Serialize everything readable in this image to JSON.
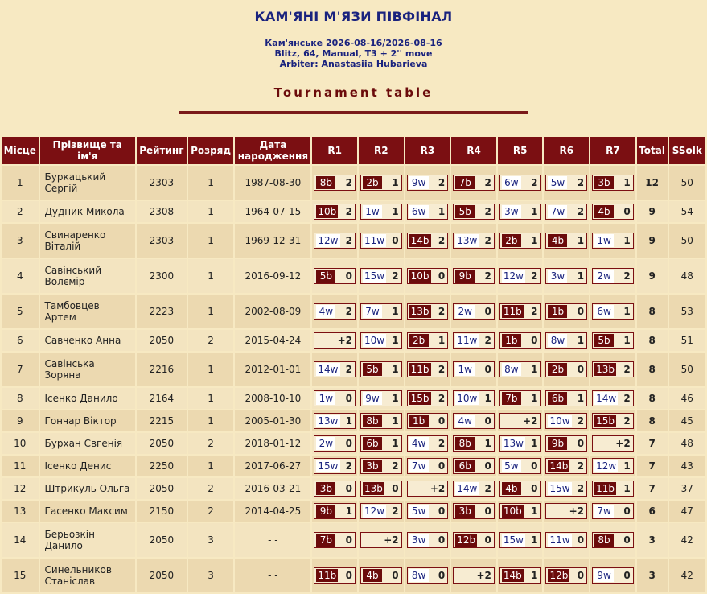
{
  "header": {
    "title": "КАМ'ЯНІ М'ЯЗИ ПІВФІНАЛ",
    "info_line1": "Кам'янське 2026-08-16/2026-08-16",
    "info_line2": "Blitz, 64, Manual, T3 + 2'' move",
    "info_line3": "Arbiter: Anastasiia Hubarieva",
    "subtitle": "Tournament table"
  },
  "columns": [
    "Місце",
    "Прізвище та ім'я",
    "Рейтинг",
    "Розряд",
    "Дата народження",
    "R1",
    "R2",
    "R3",
    "R4",
    "R5",
    "R6",
    "R7",
    "Total",
    "SSolk"
  ],
  "rows": [
    {
      "place": "1",
      "name1": "Буркацький",
      "name2": "Сергій",
      "rating": "2303",
      "rank": "1",
      "dob": "1987-08-30",
      "games": [
        [
          "8b",
          "2"
        ],
        [
          "2b",
          "1"
        ],
        [
          "9w",
          "2"
        ],
        [
          "7b",
          "2"
        ],
        [
          "6w",
          "2"
        ],
        [
          "5w",
          "2"
        ],
        [
          "3b",
          "1"
        ]
      ],
      "total": "12",
      "ssolk": "50"
    },
    {
      "place": "2",
      "name1": "Дудник Микола",
      "name2": "",
      "rating": "2308",
      "rank": "1",
      "dob": "1964-07-15",
      "games": [
        [
          "10b",
          "2"
        ],
        [
          "1w",
          "1"
        ],
        [
          "6w",
          "1"
        ],
        [
          "5b",
          "2"
        ],
        [
          "3w",
          "1"
        ],
        [
          "7w",
          "2"
        ],
        [
          "4b",
          "0"
        ]
      ],
      "total": "9",
      "ssolk": "54"
    },
    {
      "place": "3",
      "name1": "Свинаренко",
      "name2": "Віталій",
      "rating": "2303",
      "rank": "1",
      "dob": "1969-12-31",
      "games": [
        [
          "12w",
          "2"
        ],
        [
          "11w",
          "0"
        ],
        [
          "14b",
          "2"
        ],
        [
          "13w",
          "2"
        ],
        [
          "2b",
          "1"
        ],
        [
          "4b",
          "1"
        ],
        [
          "1w",
          "1"
        ]
      ],
      "total": "9",
      "ssolk": "50"
    },
    {
      "place": "4",
      "name1": "Савінський",
      "name2": "Волємір",
      "rating": "2300",
      "rank": "1",
      "dob": "2016-09-12",
      "games": [
        [
          "5b",
          "0"
        ],
        [
          "15w",
          "2"
        ],
        [
          "10b",
          "0"
        ],
        [
          "9b",
          "2"
        ],
        [
          "12w",
          "2"
        ],
        [
          "3w",
          "1"
        ],
        [
          "2w",
          "2"
        ]
      ],
      "total": "9",
      "ssolk": "48"
    },
    {
      "place": "5",
      "name1": "Тамбовцев",
      "name2": "Артем",
      "rating": "2223",
      "rank": "1",
      "dob": "2002-08-09",
      "games": [
        [
          "4w",
          "2"
        ],
        [
          "7w",
          "1"
        ],
        [
          "13b",
          "2"
        ],
        [
          "2w",
          "0"
        ],
        [
          "11b",
          "2"
        ],
        [
          "1b",
          "0"
        ],
        [
          "6w",
          "1"
        ]
      ],
      "total": "8",
      "ssolk": "53"
    },
    {
      "place": "6",
      "name1": "Савченко Анна",
      "name2": "",
      "rating": "2050",
      "rank": "2",
      "dob": "2015-04-24",
      "games": [
        [
          "",
          "+2"
        ],
        [
          "10w",
          "1"
        ],
        [
          "2b",
          "1"
        ],
        [
          "11w",
          "2"
        ],
        [
          "1b",
          "0"
        ],
        [
          "8w",
          "1"
        ],
        [
          "5b",
          "1"
        ]
      ],
      "total": "8",
      "ssolk": "51"
    },
    {
      "place": "7",
      "name1": "Савінська",
      "name2": "Зоряна",
      "rating": "2216",
      "rank": "1",
      "dob": "2012-01-01",
      "games": [
        [
          "14w",
          "2"
        ],
        [
          "5b",
          "1"
        ],
        [
          "11b",
          "2"
        ],
        [
          "1w",
          "0"
        ],
        [
          "8w",
          "1"
        ],
        [
          "2b",
          "0"
        ],
        [
          "13b",
          "2"
        ]
      ],
      "total": "8",
      "ssolk": "50"
    },
    {
      "place": "8",
      "name1": "Ісенко Данило",
      "name2": "",
      "rating": "2164",
      "rank": "1",
      "dob": "2008-10-10",
      "games": [
        [
          "1w",
          "0"
        ],
        [
          "9w",
          "1"
        ],
        [
          "15b",
          "2"
        ],
        [
          "10w",
          "1"
        ],
        [
          "7b",
          "1"
        ],
        [
          "6b",
          "1"
        ],
        [
          "14w",
          "2"
        ]
      ],
      "total": "8",
      "ssolk": "46"
    },
    {
      "place": "9",
      "name1": "Гончар Віктор",
      "name2": "",
      "rating": "2215",
      "rank": "1",
      "dob": "2005-01-30",
      "games": [
        [
          "13w",
          "1"
        ],
        [
          "8b",
          "1"
        ],
        [
          "1b",
          "0"
        ],
        [
          "4w",
          "0"
        ],
        [
          "",
          "+2"
        ],
        [
          "10w",
          "2"
        ],
        [
          "15b",
          "2"
        ]
      ],
      "total": "8",
      "ssolk": "45"
    },
    {
      "place": "10",
      "name1": "Бурхан Євгенія",
      "name2": "",
      "rating": "2050",
      "rank": "2",
      "dob": "2018-01-12",
      "games": [
        [
          "2w",
          "0"
        ],
        [
          "6b",
          "1"
        ],
        [
          "4w",
          "2"
        ],
        [
          "8b",
          "1"
        ],
        [
          "13w",
          "1"
        ],
        [
          "9b",
          "0"
        ],
        [
          "",
          "+2"
        ]
      ],
      "total": "7",
      "ssolk": "48"
    },
    {
      "place": "11",
      "name1": "Ісенко Денис",
      "name2": "",
      "rating": "2250",
      "rank": "1",
      "dob": "2017-06-27",
      "games": [
        [
          "15w",
          "2"
        ],
        [
          "3b",
          "2"
        ],
        [
          "7w",
          "0"
        ],
        [
          "6b",
          "0"
        ],
        [
          "5w",
          "0"
        ],
        [
          "14b",
          "2"
        ],
        [
          "12w",
          "1"
        ]
      ],
      "total": "7",
      "ssolk": "43"
    },
    {
      "place": "12",
      "name1": "Штрикуль Ольга",
      "name2": "",
      "rating": "2050",
      "rank": "2",
      "dob": "2016-03-21",
      "games": [
        [
          "3b",
          "0"
        ],
        [
          "13b",
          "0"
        ],
        [
          "",
          "+2"
        ],
        [
          "14w",
          "2"
        ],
        [
          "4b",
          "0"
        ],
        [
          "15w",
          "2"
        ],
        [
          "11b",
          "1"
        ]
      ],
      "total": "7",
      "ssolk": "37"
    },
    {
      "place": "13",
      "name1": "Гасенко Максим",
      "name2": "",
      "rating": "2150",
      "rank": "2",
      "dob": "2014-04-25",
      "games": [
        [
          "9b",
          "1"
        ],
        [
          "12w",
          "2"
        ],
        [
          "5w",
          "0"
        ],
        [
          "3b",
          "0"
        ],
        [
          "10b",
          "1"
        ],
        [
          "",
          "+2"
        ],
        [
          "7w",
          "0"
        ]
      ],
      "total": "6",
      "ssolk": "47"
    },
    {
      "place": "14",
      "name1": "Берьозкін",
      "name2": "Данило",
      "rating": "2050",
      "rank": "3",
      "dob": "- -",
      "games": [
        [
          "7b",
          "0"
        ],
        [
          "",
          "+2"
        ],
        [
          "3w",
          "0"
        ],
        [
          "12b",
          "0"
        ],
        [
          "15w",
          "1"
        ],
        [
          "11w",
          "0"
        ],
        [
          "8b",
          "0"
        ]
      ],
      "total": "3",
      "ssolk": "42"
    },
    {
      "place": "15",
      "name1": "Синельников",
      "name2": "Станіслав",
      "rating": "2050",
      "rank": "3",
      "dob": "- -",
      "games": [
        [
          "11b",
          "0"
        ],
        [
          "4b",
          "0"
        ],
        [
          "8w",
          "0"
        ],
        [
          "",
          "+2"
        ],
        [
          "14b",
          "1"
        ],
        [
          "12b",
          "0"
        ],
        [
          "9w",
          "0"
        ]
      ],
      "total": "3",
      "ssolk": "42"
    }
  ]
}
